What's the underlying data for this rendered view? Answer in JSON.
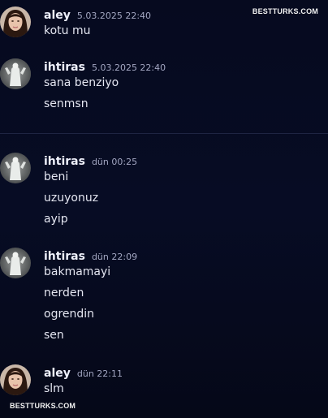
{
  "watermark": "BESTTURKS.COM",
  "messages": [
    {
      "user": "aley",
      "time": "5.03.2025 22:40",
      "avatar": "woman-avatar",
      "lines": [
        "kotu mu"
      ]
    },
    {
      "user": "ihtiras",
      "time": "5.03.2025 22:40",
      "avatar": "statue-avatar",
      "lines": [
        "sana benziyo",
        "senmsn"
      ]
    },
    {
      "user": "ihtiras",
      "time": "dün 00:25",
      "avatar": "statue-avatar",
      "lines": [
        "beni",
        "uzuyonuz",
        "ayip"
      ]
    },
    {
      "user": "ihtiras",
      "time": "dün 22:09",
      "avatar": "statue-avatar",
      "lines": [
        "bakmamayi",
        "nerden",
        "ogrendin",
        "sen"
      ]
    },
    {
      "user": "aley",
      "time": "dün 22:11",
      "avatar": "woman-avatar",
      "lines": [
        "slm"
      ]
    }
  ]
}
